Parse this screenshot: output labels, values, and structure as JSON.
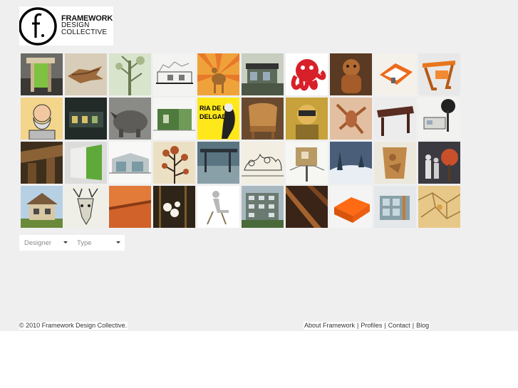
{
  "logo": {
    "line1": "FRAMEWORK",
    "line2": "DESIGN",
    "line3": "COLLECTIVE"
  },
  "thumbnails": [
    {
      "label": "green chair",
      "icon": "chair-thumb"
    },
    {
      "label": "wooden shark",
      "icon": "carving-thumb"
    },
    {
      "label": "tree sketch",
      "icon": "tree-thumb"
    },
    {
      "label": "building sketch",
      "icon": "sketch-thumb"
    },
    {
      "label": "deer poster",
      "icon": "deer-thumb"
    },
    {
      "label": "pavilion",
      "icon": "building-thumb"
    },
    {
      "label": "red octopus",
      "icon": "octopus-thumb"
    },
    {
      "label": "bear figure",
      "icon": "figure-thumb"
    },
    {
      "label": "orange room model",
      "icon": "model-thumb"
    },
    {
      "label": "orange desk",
      "icon": "desk-thumb"
    },
    {
      "label": "bearded man",
      "icon": "portrait-thumb"
    },
    {
      "label": "night building",
      "icon": "night-thumb"
    },
    {
      "label": "rhino",
      "icon": "rhino-thumb"
    },
    {
      "label": "green house",
      "icon": "house-thumb"
    },
    {
      "label": "ria de un delgado",
      "icon": "poster-thumb"
    },
    {
      "label": "wood chair",
      "icon": "chair-thumb"
    },
    {
      "label": "man with glasses",
      "icon": "portrait-thumb"
    },
    {
      "label": "lobster drawing",
      "icon": "lobster-thumb"
    },
    {
      "label": "dark table",
      "icon": "table-thumb"
    },
    {
      "label": "tree house",
      "icon": "treehouse-thumb"
    },
    {
      "label": "wood joinery",
      "icon": "wood-thumb"
    },
    {
      "label": "green panel",
      "icon": "panel-thumb"
    },
    {
      "label": "glass house",
      "icon": "house-thumb"
    },
    {
      "label": "circle tree",
      "icon": "tree-thumb"
    },
    {
      "label": "bus shelter",
      "icon": "shelter-thumb"
    },
    {
      "label": "crowd sketch",
      "icon": "sketch-thumb"
    },
    {
      "label": "tree pod",
      "icon": "pod-thumb"
    },
    {
      "label": "snow scene",
      "icon": "snow-thumb"
    },
    {
      "label": "wood relief",
      "icon": "relief-thumb"
    },
    {
      "label": "people and tree",
      "icon": "people-thumb"
    },
    {
      "label": "cottage",
      "icon": "house-thumb"
    },
    {
      "label": "deer drawing",
      "icon": "deer-thumb"
    },
    {
      "label": "orange wall",
      "icon": "wall-thumb"
    },
    {
      "label": "lamps",
      "icon": "lamp-thumb"
    },
    {
      "label": "seated figure",
      "icon": "figure-thumb"
    },
    {
      "label": "apartment block",
      "icon": "building-thumb"
    },
    {
      "label": "diagonal beam",
      "icon": "beam-thumb"
    },
    {
      "label": "orange structure",
      "icon": "model-thumb"
    },
    {
      "label": "glass building",
      "icon": "building-thumb"
    },
    {
      "label": "map pattern",
      "icon": "map-thumb"
    }
  ],
  "filters": {
    "designer": "Designer",
    "type": "Type"
  },
  "footer": {
    "copyright": "© 2010 Framework Design Collective.",
    "links": [
      "About Framework",
      "Profiles",
      "Contact",
      "Blog"
    ],
    "separator": "|"
  }
}
